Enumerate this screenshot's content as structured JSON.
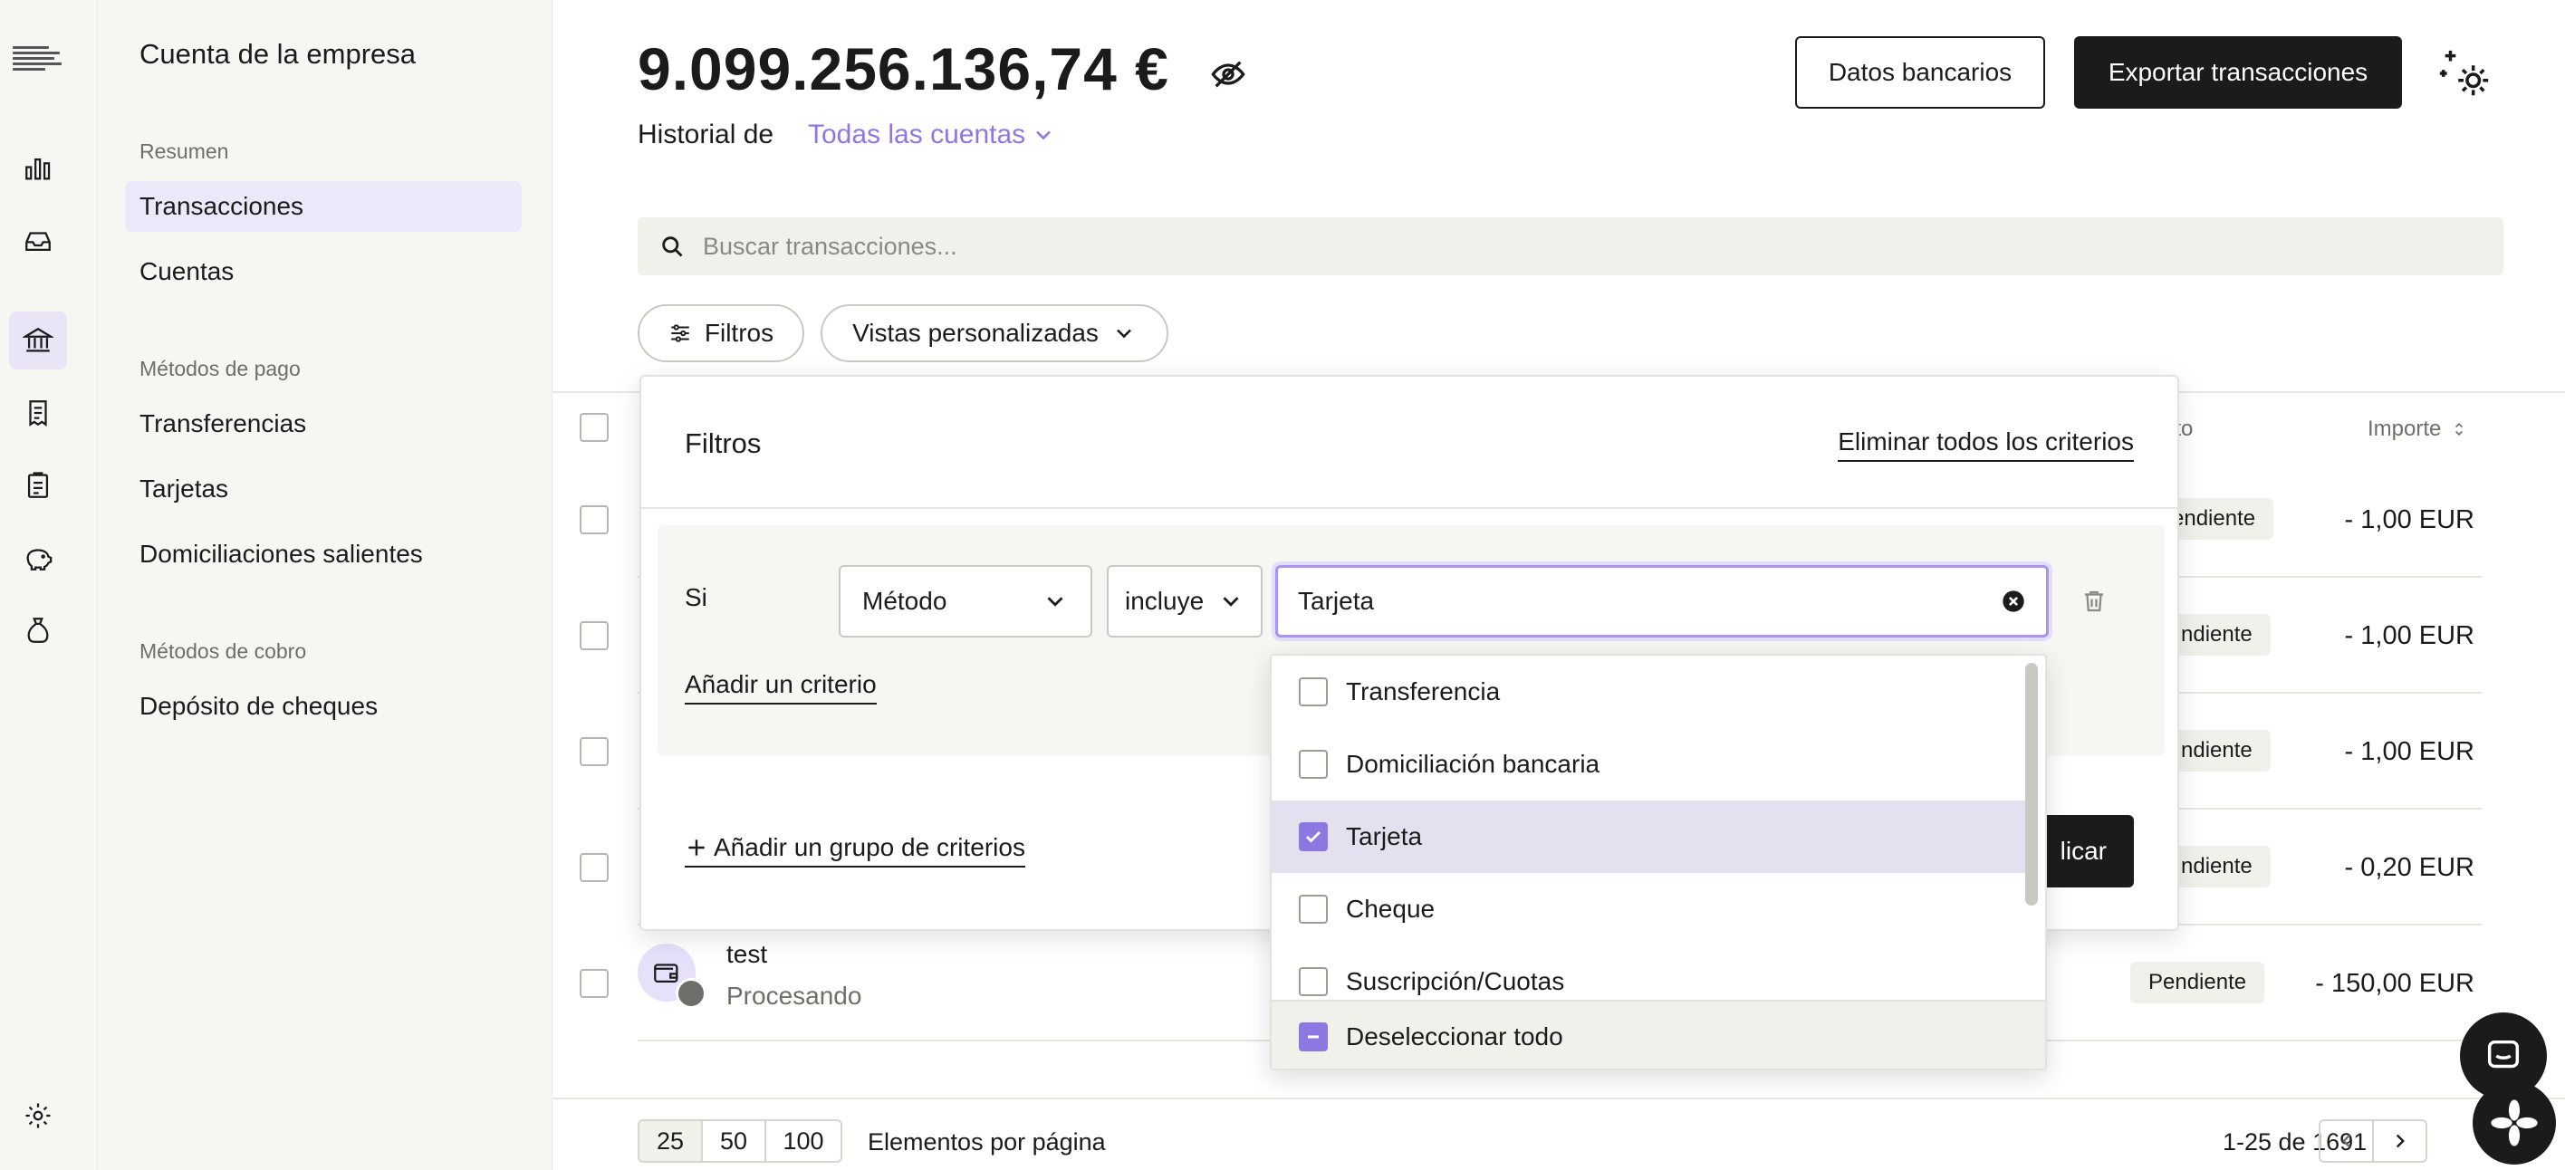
{
  "colors": {
    "accent": "#8d77e0",
    "dark": "#1b1b1b",
    "sidebar_bg": "#f6f6f3",
    "active_item_bg": "#ebe8f9"
  },
  "rail": {
    "icons": [
      "company-logo",
      "bar-chart-icon",
      "inbox-icon",
      "bank-icon",
      "invoice-icon",
      "clipboard-icon",
      "piggy-bank-icon",
      "money-bag-icon",
      "settings-icon"
    ]
  },
  "sidebar": {
    "title": "Cuenta de la empresa",
    "section_summary": "Resumen",
    "item_transactions": "Transacciones",
    "item_accounts": "Cuentas",
    "section_payment": "Métodos de pago",
    "item_transfers": "Transferencias",
    "item_cards": "Tarjetas",
    "item_direct_debits": "Domiciliaciones salientes",
    "section_collection": "Métodos de cobro",
    "item_check_deposit": "Depósito de cheques"
  },
  "header": {
    "balance": "9.099.256.136,74 €",
    "history_label": "Historial de",
    "history_account": "Todas las cuentas",
    "bank_details_button": "Datos bancarios",
    "export_button": "Exportar transacciones"
  },
  "search": {
    "placeholder": "Buscar transacciones..."
  },
  "toolbar": {
    "filters_label": "Filtros",
    "custom_views_label": "Vistas personalizadas"
  },
  "table": {
    "col_method": "nto",
    "col_amount": "Importe",
    "rows": [
      {
        "status": "Pendiente",
        "amount": "- 1,00 EUR"
      },
      {
        "status": "ndiente",
        "amount": "- 1,00 EUR"
      },
      {
        "status": "ndiente",
        "amount": "- 1,00 EUR"
      },
      {
        "status": "ndiente",
        "amount": "- 0,20 EUR"
      },
      {
        "name": "test",
        "sub": "Procesando",
        "status": "Pendiente",
        "amount": "- 150,00 EUR"
      }
    ]
  },
  "filter_panel": {
    "title": "Filtros",
    "clear_all": "Eliminar todos los criterios",
    "condition_if": "Si",
    "field_select": "Método",
    "operator_select": "incluye",
    "value_input": "Tarjeta",
    "add_criterion": "Añadir un criterio",
    "add_group": "Añadir un grupo de criterios",
    "apply": "licar"
  },
  "dropdown": {
    "options": [
      {
        "label": "Transferencia",
        "checked": false
      },
      {
        "label": "Domiciliación bancaria",
        "checked": false
      },
      {
        "label": "Tarjeta",
        "checked": true
      },
      {
        "label": "Cheque",
        "checked": false
      },
      {
        "label": "Suscripción/Cuotas",
        "checked": false
      }
    ],
    "deselect_all": "Deseleccionar todo"
  },
  "pagination": {
    "sizes": [
      "25",
      "50",
      "100"
    ],
    "selected_size": "25",
    "per_page_label": "Elementos por página",
    "range": "1-25 de 1691"
  }
}
